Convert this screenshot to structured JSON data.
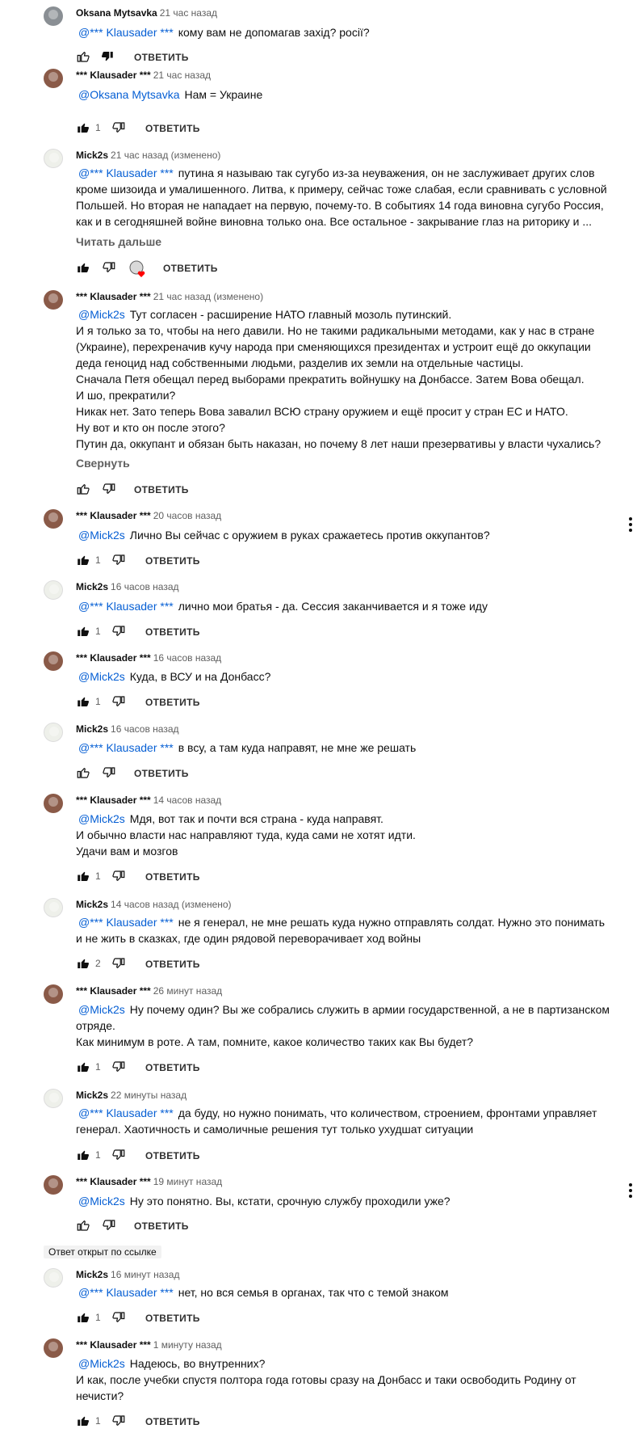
{
  "comments": [
    {
      "avatar": "user-avatar",
      "author": "Oksana Mytsavka",
      "time": "21 час назад",
      "mention": "@*** Klausader ***",
      "lines": [
        "кому вам не допомагав захід? росії?"
      ],
      "likes": "",
      "reply": "ОТВЕТИТЬ"
    },
    {
      "avatar": "user-avatar",
      "author": "*** Klausader ***",
      "time": "21 час назад",
      "mention": "@Oksana Mytsavka",
      "lines": [
        "Нам = Украине"
      ],
      "likes": "1",
      "reply": "ОТВЕТИТЬ"
    },
    {
      "avatar": "user-avatar",
      "author": "Mick2s",
      "time": "21 час назад (изменено)",
      "mention": "@*** Klausader ***",
      "lines": [
        "путина я называю так сугубо из-за неуважения, он не заслуживает других слов",
        "кроме шизоида и умалишенного. Литва, к примеру, сейчас тоже слабая, если сравнивать с условной",
        "Польшей. Но вторая не нападает на первую, почему-то. В событиях 14 года виновна сугубо Россия,",
        "как и в сегодняшней войне виновна только она. Все остальное - закрывание глаз на риторику и ..."
      ],
      "more": "Читать дальше",
      "likes": "",
      "reply": "ОТВЕТИТЬ"
    },
    {
      "avatar": "user-avatar",
      "author": "*** Klausader ***",
      "time": "21 час назад (изменено)",
      "mention": "@Mick2s",
      "lines": [
        "Тут согласен - расширение НАТО главный мозоль путинский.",
        "И я только за то, чтобы на него давили. Но не такими радикальными методами, как у нас в стране",
        "(Украине), перехреначив кучу народа при сменяющихся президентах и устроит ещё до оккупации",
        "деда геноцид над собственными людьми, разделив их земли на отдельные частицы.",
        "Сначала Петя обещал перед выборами прекратить войнушку на Донбассе. Затем Вова обещал.",
        "И шо, прекратили?",
        "Никак нет. Зато теперь Вова завалил ВСЮ страну оружием и ещё просит у стран ЕС и НАТО.",
        "Ну вот и кто он после этого?",
        "Путин да, оккупант и обязан быть наказан, но почему 8 лет наши презервативы у власти чухались?"
      ],
      "more": "Свернуть",
      "likes": "",
      "reply": "ОТВЕТИТЬ"
    },
    {
      "avatar": "user-avatar",
      "author": "*** Klausader ***",
      "time": "20 часов назад",
      "mention": "@Mick2s",
      "lines": [
        "Лично Вы сейчас с оружием в руках сражаетесь против оккупантов?"
      ],
      "likes": "1",
      "reply": "ОТВЕТИТЬ"
    },
    {
      "avatar": "user-avatar",
      "author": "Mick2s",
      "time": "16 часов назад",
      "mention": "@*** Klausader ***",
      "lines": [
        "лично мои братья - да. Сессия заканчивается и я тоже иду"
      ],
      "likes": "1",
      "reply": "ОТВЕТИТЬ"
    },
    {
      "avatar": "user-avatar",
      "author": "*** Klausader ***",
      "time": "16 часов назад",
      "mention": "@Mick2s",
      "lines": [
        "Куда, в ВСУ и на Донбасс?"
      ],
      "likes": "1",
      "reply": "ОТВЕТИТЬ"
    },
    {
      "avatar": "user-avatar",
      "author": "Mick2s",
      "time": "16 часов назад",
      "mention": "@*** Klausader ***",
      "lines": [
        "в всу, а там куда направят, не мне же решать"
      ],
      "likes": "",
      "reply": "ОТВЕТИТЬ"
    },
    {
      "avatar": "user-avatar",
      "author": "*** Klausader ***",
      "time": "14 часов назад",
      "mention": "@Mick2s",
      "lines": [
        "Мдя, вот так и почти вся страна - куда направят.",
        "И обычно власти нас направляют туда, куда сами не хотят идти.",
        "Удачи вам и мозгов"
      ],
      "likes": "1",
      "reply": "ОТВЕТИТЬ"
    },
    {
      "avatar": "user-avatar",
      "author": "Mick2s",
      "time": "14 часов назад (изменено)",
      "mention": "@*** Klausader ***",
      "lines": [
        "не я генерал, не мне решать куда нужно отправлять солдат. Нужно это понимать",
        "и не жить в сказках, где один рядовой переворачивает ход войны"
      ],
      "likes": "2",
      "reply": "ОТВЕТИТЬ"
    },
    {
      "avatar": "user-avatar",
      "author": "*** Klausader ***",
      "time": "26 минут назад",
      "mention": "@Mick2s",
      "lines": [
        "Ну почему один? Вы же собрались служить в армии государственной, а не в партизанском",
        "отряде.",
        "Как минимум в роте. А там, помните, какое количество таких как Вы будет?"
      ],
      "likes": "1",
      "reply": "ОТВЕТИТЬ"
    },
    {
      "avatar": "user-avatar",
      "author": "Mick2s",
      "time": "22 минуты назад",
      "mention": "@*** Klausader ***",
      "lines": [
        "да буду, но нужно понимать, что количеством, строением, фронтами управляет",
        "генерал. Хаотичность и самоличные решения тут только ухудшат ситуации"
      ],
      "likes": "1",
      "reply": "ОТВЕТИТЬ"
    },
    {
      "avatar": "user-avatar",
      "author": "*** Klausader ***",
      "time": "19 минут назад",
      "mention": "@Mick2s",
      "lines": [
        "Ну это понятно. Вы, кстати, срочную службу проходили уже?"
      ],
      "likes": "",
      "reply": "ОТВЕТИТЬ"
    },
    {
      "avatar": "user-avatar",
      "author": "Mick2s",
      "time": "16 минут назад",
      "mention": "@*** Klausader ***",
      "lines": [
        "нет, но вся семья в органах, так что с темой знаком"
      ],
      "likes": "1",
      "reply": "ОТВЕТИТЬ"
    },
    {
      "avatar": "user-avatar",
      "author": "*** Klausader ***",
      "time": "1 минуту назад",
      "mention": "@Mick2s",
      "lines": [
        "Надеюсь, во внутренних?",
        "И как, после учебки спустя полтора года готовы сразу на Донбасс и таки освободить Родину от",
        "нечисти?"
      ],
      "likes": "1",
      "reply": "ОТВЕТИТЬ"
    }
  ],
  "badge": "Ответ открыт по ссылке",
  "colors": {
    "mention": "#065fd4",
    "meta": "#606060",
    "heart": "#ff0000"
  }
}
